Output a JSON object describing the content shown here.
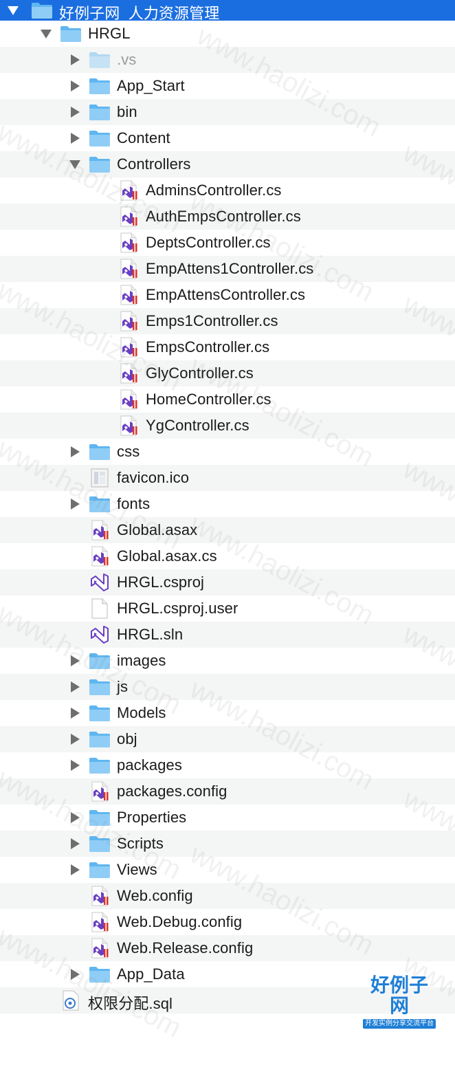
{
  "tree": [
    {
      "label": "好例子网_人力资源管理",
      "kind": "folder",
      "depth": 0,
      "disclosure": "open",
      "selected": true
    },
    {
      "label": "HRGL",
      "kind": "folder",
      "depth": 1,
      "disclosure": "open"
    },
    {
      "label": ".vs",
      "kind": "folder",
      "depth": 2,
      "disclosure": "closed",
      "dim": true
    },
    {
      "label": "App_Start",
      "kind": "folder",
      "depth": 2,
      "disclosure": "closed"
    },
    {
      "label": "bin",
      "kind": "folder",
      "depth": 2,
      "disclosure": "closed"
    },
    {
      "label": "Content",
      "kind": "folder",
      "depth": 2,
      "disclosure": "closed"
    },
    {
      "label": "Controllers",
      "kind": "folder",
      "depth": 2,
      "disclosure": "open"
    },
    {
      "label": "AdminsController.cs",
      "kind": "vs-file",
      "depth": 3
    },
    {
      "label": "AuthEmpsController.cs",
      "kind": "vs-file",
      "depth": 3
    },
    {
      "label": "DeptsController.cs",
      "kind": "vs-file",
      "depth": 3
    },
    {
      "label": "EmpAttens1Controller.cs",
      "kind": "vs-file",
      "depth": 3
    },
    {
      "label": "EmpAttensController.cs",
      "kind": "vs-file",
      "depth": 3
    },
    {
      "label": "Emps1Controller.cs",
      "kind": "vs-file",
      "depth": 3
    },
    {
      "label": "EmpsController.cs",
      "kind": "vs-file",
      "depth": 3
    },
    {
      "label": "GlyController.cs",
      "kind": "vs-file",
      "depth": 3
    },
    {
      "label": "HomeController.cs",
      "kind": "vs-file",
      "depth": 3
    },
    {
      "label": "YgController.cs",
      "kind": "vs-file",
      "depth": 3
    },
    {
      "label": "css",
      "kind": "folder",
      "depth": 2,
      "disclosure": "closed"
    },
    {
      "label": "favicon.ico",
      "kind": "ico-file",
      "depth": 2
    },
    {
      "label": "fonts",
      "kind": "folder",
      "depth": 2,
      "disclosure": "closed"
    },
    {
      "label": "Global.asax",
      "kind": "vs-file",
      "depth": 2
    },
    {
      "label": "Global.asax.cs",
      "kind": "vs-file",
      "depth": 2
    },
    {
      "label": "HRGL.csproj",
      "kind": "vs-project",
      "depth": 2
    },
    {
      "label": "HRGL.csproj.user",
      "kind": "blank-file",
      "depth": 2
    },
    {
      "label": "HRGL.sln",
      "kind": "vs-project",
      "depth": 2
    },
    {
      "label": "images",
      "kind": "folder",
      "depth": 2,
      "disclosure": "closed"
    },
    {
      "label": "js",
      "kind": "folder",
      "depth": 2,
      "disclosure": "closed"
    },
    {
      "label": "Models",
      "kind": "folder",
      "depth": 2,
      "disclosure": "closed"
    },
    {
      "label": "obj",
      "kind": "folder",
      "depth": 2,
      "disclosure": "closed"
    },
    {
      "label": "packages",
      "kind": "folder",
      "depth": 2,
      "disclosure": "closed"
    },
    {
      "label": "packages.config",
      "kind": "vs-file",
      "depth": 2
    },
    {
      "label": "Properties",
      "kind": "folder",
      "depth": 2,
      "disclosure": "closed"
    },
    {
      "label": "Scripts",
      "kind": "folder",
      "depth": 2,
      "disclosure": "closed"
    },
    {
      "label": "Views",
      "kind": "folder",
      "depth": 2,
      "disclosure": "closed"
    },
    {
      "label": "Web.config",
      "kind": "vs-file",
      "depth": 2
    },
    {
      "label": "Web.Debug.config",
      "kind": "vs-file",
      "depth": 2
    },
    {
      "label": "Web.Release.config",
      "kind": "vs-file",
      "depth": 2
    },
    {
      "label": "App_Data",
      "kind": "folder",
      "depth": 2,
      "disclosure": "closed"
    },
    {
      "label": "权限分配.sql",
      "kind": "sql-file",
      "depth": 1
    }
  ],
  "watermark": "www.haolizi.com",
  "logo": {
    "name": "好例子网",
    "tagline": "开发实例分享交流平台"
  },
  "colors": {
    "selection": "#1b6ee0",
    "folder": "#5fb6f0",
    "vs_purple": "#6a3fc1",
    "vs_red": "#d9342b",
    "row_alt": "#f4f5f5"
  }
}
